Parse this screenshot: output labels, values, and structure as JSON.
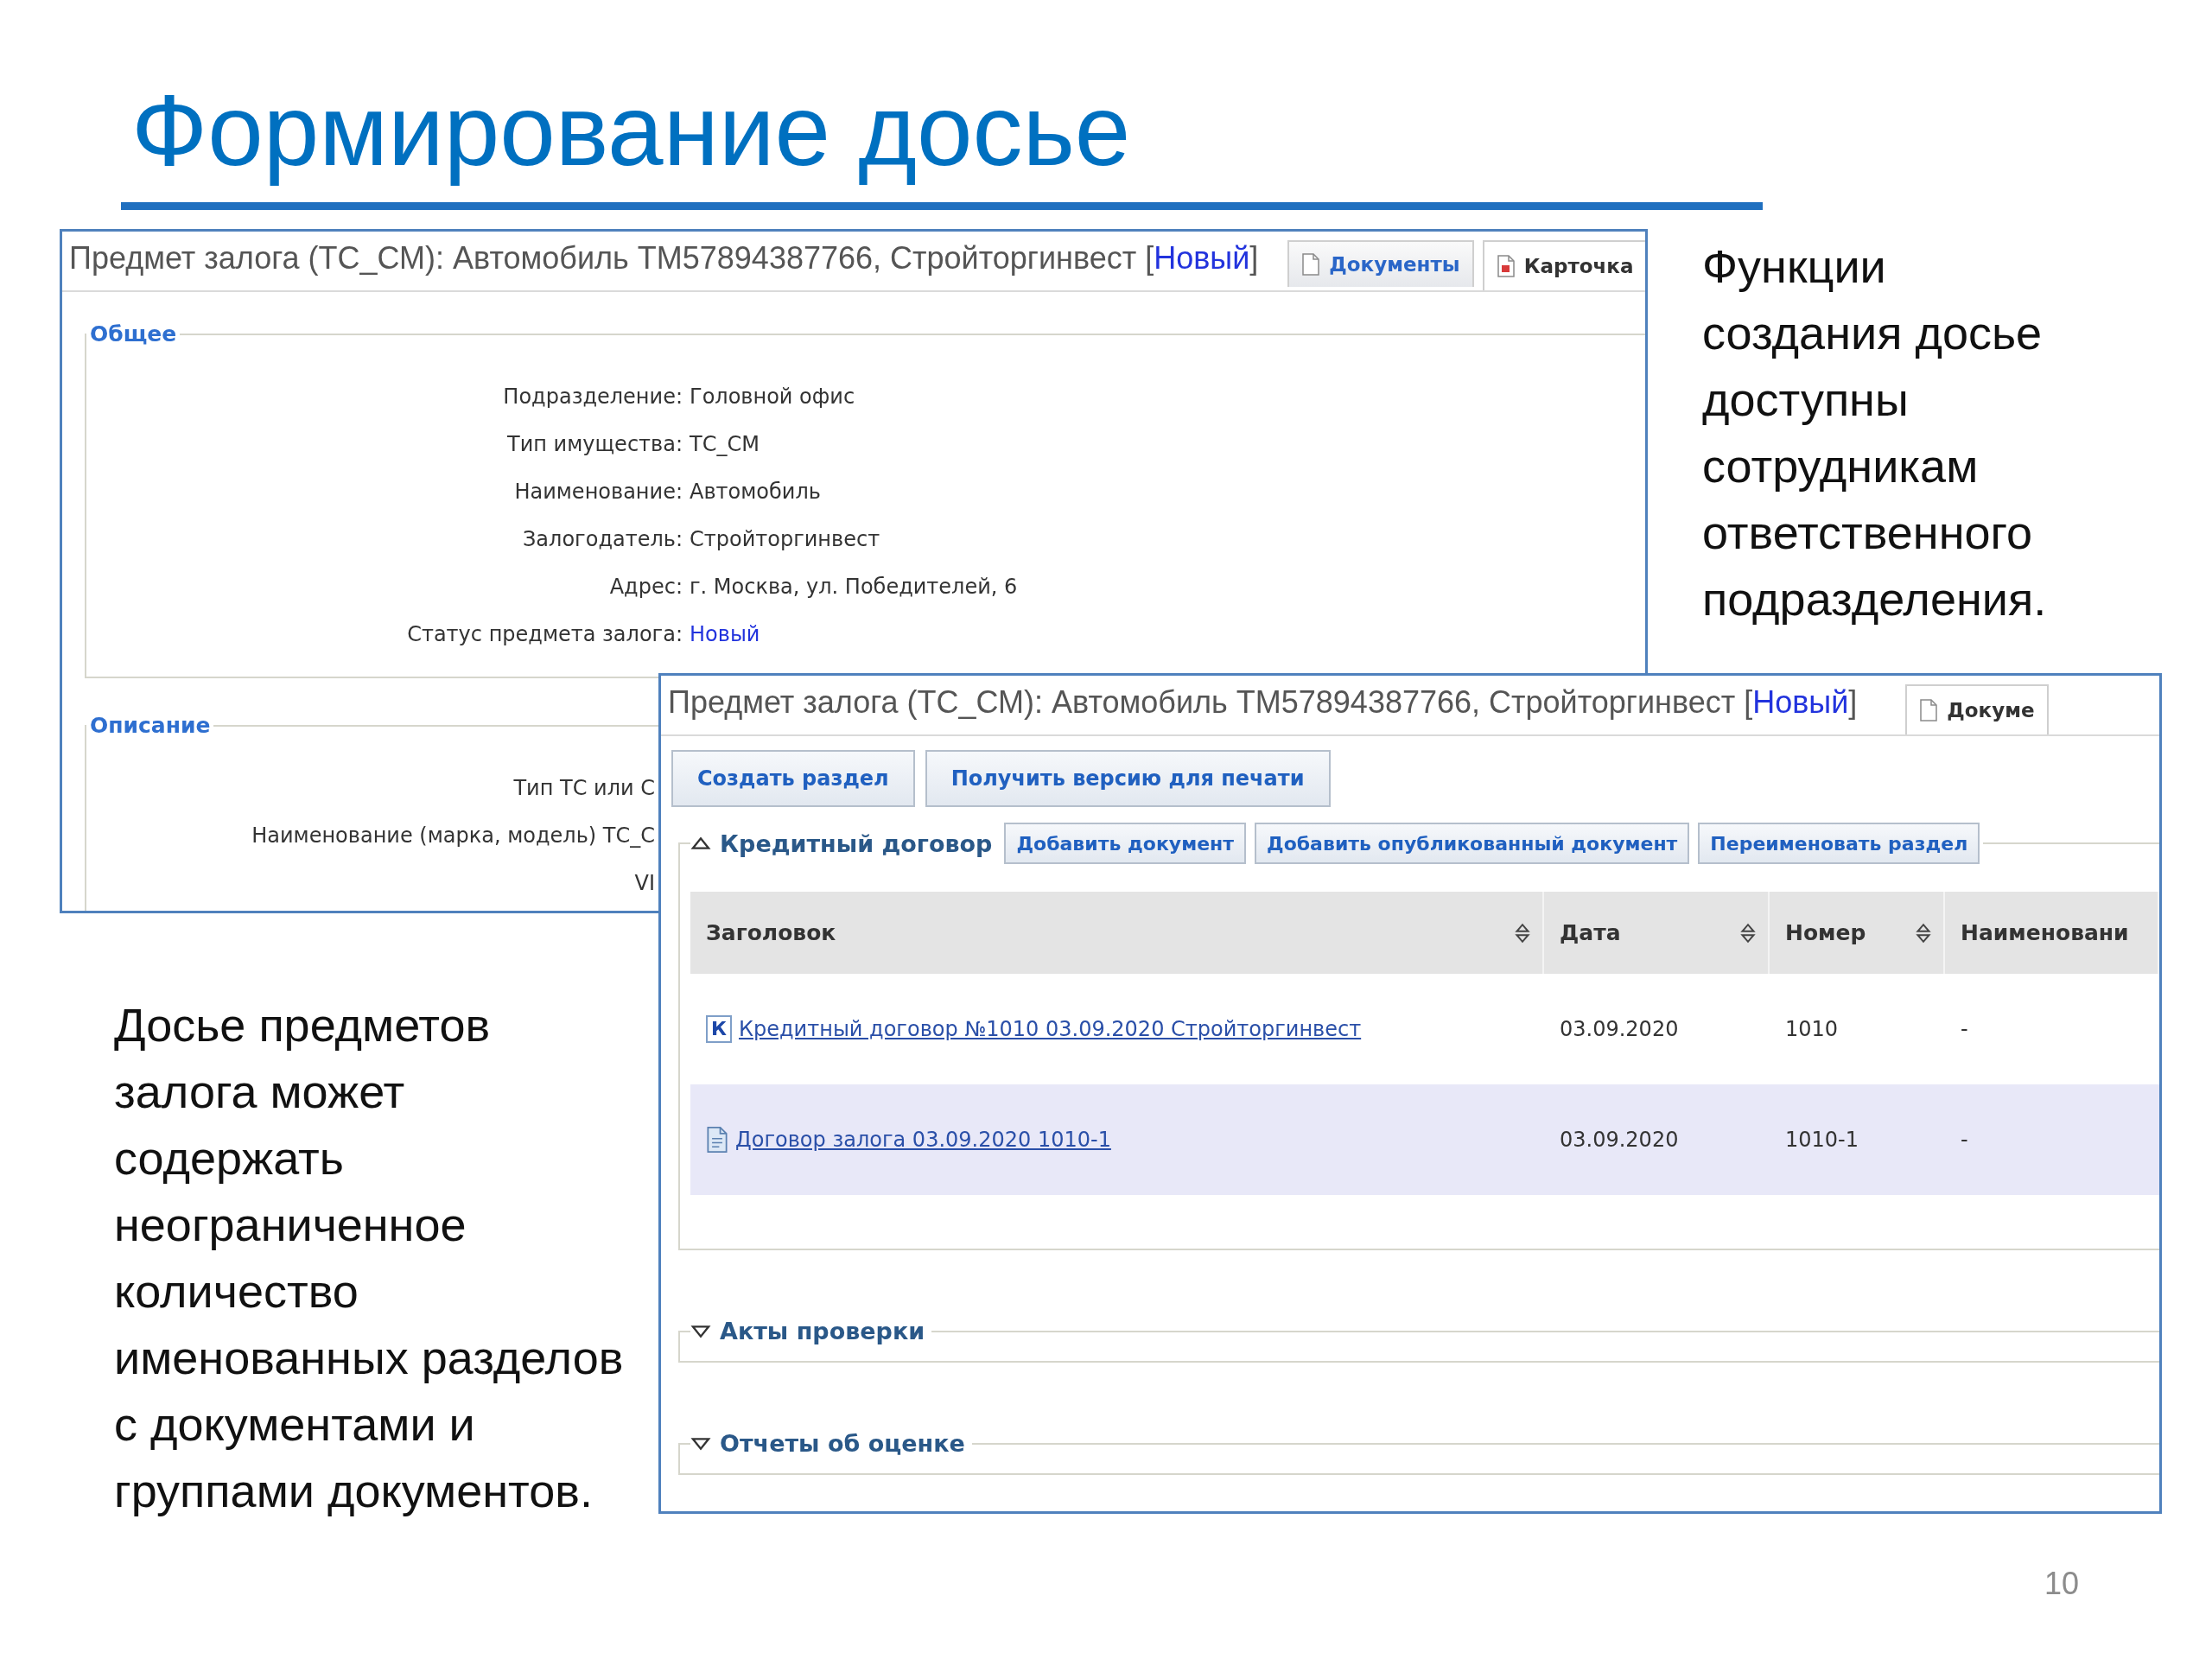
{
  "title": "Формирование досье",
  "card_window": {
    "title": "Предмет залога (ТС_СМ): Автомобиль ТМ57894387766, Стройторгинвест [",
    "status": "Новый",
    "title_end": "]",
    "tabs": [
      {
        "label": "Документы",
        "kind": "document",
        "selected": false
      },
      {
        "label": "Карточка",
        "kind": "pdf",
        "selected": true
      }
    ],
    "groups": [
      {
        "legend": "Общее",
        "fields": [
          {
            "kind": "text",
            "label": "Подразделение:",
            "value": "Головной офис"
          },
          {
            "kind": "text",
            "label": "Тип имущества:",
            "value": "ТС_СМ"
          },
          {
            "kind": "text",
            "label": "Наименование:",
            "value": "Автомобиль"
          },
          {
            "kind": "text",
            "label": "Залогодатель:",
            "value": "Стройторгинвест"
          },
          {
            "kind": "text",
            "label": "Адрес:",
            "value": "г. Москва, ул. Победителей, 6"
          },
          {
            "kind": "status",
            "label": "Статус предмета залога:",
            "value": "Новый"
          }
        ]
      },
      {
        "legend": "Описание",
        "fields": [
          {
            "kind": "cut",
            "label": "Тип ТС или С"
          },
          {
            "kind": "cut",
            "label": "Наименование (марка, модель) ТС_С"
          },
          {
            "kind": "cut",
            "label": "VI"
          }
        ]
      }
    ]
  },
  "dossier_window": {
    "title": "Предмет залога (ТС_СМ): Автомобиль ТМ57894387766, Стройторгинвест [",
    "status": "Новый",
    "title_end": "]",
    "tabs": [
      {
        "label": "Докуме",
        "kind": "document",
        "selected": true
      }
    ],
    "toolbar": [
      "Создать раздел",
      "Получить версию для печати"
    ],
    "sections": [
      {
        "title": "Кредитный договор",
        "expanded": true,
        "actions": [
          "Добавить документ",
          "Добавить опубликованный документ",
          "Переименовать раздел"
        ],
        "table": {
          "columns": [
            {
              "label": "Заголовок",
              "sortable": true
            },
            {
              "label": "Дата",
              "sortable": true
            },
            {
              "label": "Номер",
              "sortable": true
            },
            {
              "label": "Наименовани",
              "sortable": false
            }
          ],
          "rows": [
            {
              "kind": "letter",
              "icon_letter": "К",
              "title": "Кредитный договор №1010 03.09.2020 Стройторгинвест",
              "date": "03.09.2020",
              "number": "1010",
              "name": "-",
              "selected": false
            },
            {
              "kind": "document",
              "title": "Договор залога 03.09.2020 1010-1",
              "date": "03.09.2020",
              "number": "1010-1",
              "name": "-",
              "selected": true
            }
          ]
        }
      },
      {
        "title": "Акты проверки",
        "expanded": false
      },
      {
        "title": "Отчеты об оценке",
        "expanded": false
      }
    ]
  },
  "right_note": [
    "Функции",
    "создания досье",
    "доступны",
    "сотрудникам",
    "ответственного",
    "подразделения."
  ],
  "left_note": [
    "Досье предметов",
    "залога может",
    "содержать",
    "неограниченное",
    "количество",
    "именованных разделов",
    "с документами и",
    "группами документов."
  ],
  "page_number": "10"
}
